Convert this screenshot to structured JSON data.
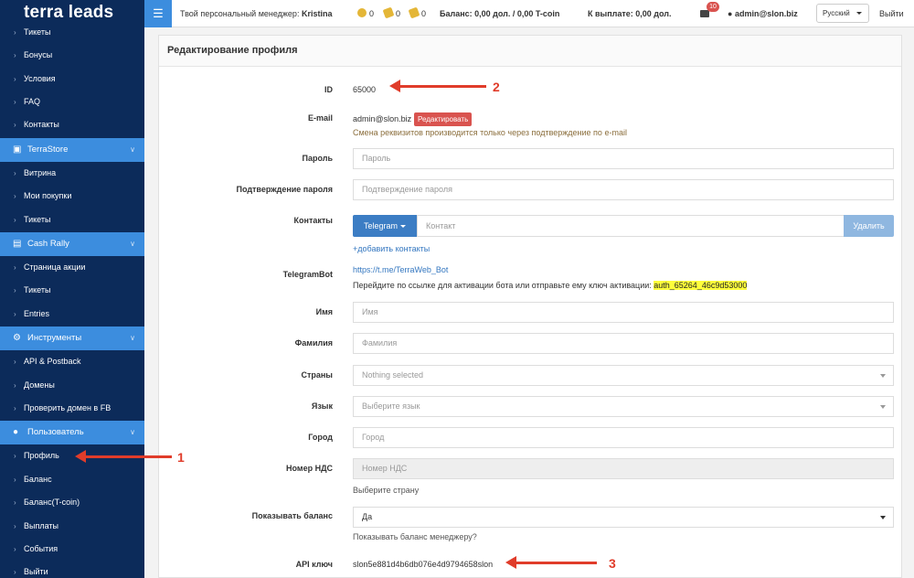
{
  "brand": "terra leads",
  "topbar": {
    "manager_prefix": "Твой персональный менеджер:",
    "manager_name": "Kristina",
    "coins": [
      "0",
      "0",
      "0"
    ],
    "balance": "Баланс: 0,00 дол. / 0,00 T-coin",
    "payout": "К выплате: 0,00 дол.",
    "notifications": "10",
    "user": "admin@slon.biz",
    "language": "Русский",
    "logout": "Выйти"
  },
  "sidebar": {
    "items_top": [
      "Тикеты",
      "Бонусы",
      "Условия",
      "FAQ",
      "Контакты"
    ],
    "terrastore": {
      "title": "TerraStore",
      "items": [
        "Витрина",
        "Мои покупки",
        "Тикеты"
      ]
    },
    "cashrally": {
      "title": "Cash Rally",
      "items": [
        "Страница акции",
        "Тикеты",
        "Entries"
      ]
    },
    "tools": {
      "title": "Инструменты",
      "items": [
        "API & Postback",
        "Домены",
        "Проверить домен в FB"
      ]
    },
    "user": {
      "title": "Пользователь",
      "items": [
        "Профиль",
        "Баланс",
        "Баланс(T-coin)",
        "Выплаты",
        "События",
        "Выйти"
      ]
    }
  },
  "panel": {
    "title": "Редактирование профиля",
    "id_label": "ID",
    "id_value": "65000",
    "email_label": "E-mail",
    "email_value": "admin@slon.biz",
    "edit_button": "Редактировать",
    "email_hint": "Смена реквизитов производится только через подтверждение по e-mail",
    "password_label": "Пароль",
    "password_placeholder": "Пароль",
    "password_confirm_label": "Подтверждение пароля",
    "password_confirm_placeholder": "Подтверждение пароля",
    "contacts_label": "Контакты",
    "contacts_type": "Telegram",
    "contact_placeholder": "Контакт",
    "delete_button": "Удалить",
    "add_contact": "+добавить контакты",
    "telegrambot_label": "TelegramBot",
    "telegrambot_link": "https://t.me/TerraWeb_Bot",
    "telegrambot_hint": "Перейдите по ссылке для активации бота или отправьте ему ключ активации:",
    "telegrambot_key": "auth_65264_46c9d53000",
    "name_label": "Имя",
    "name_placeholder": "Имя",
    "surname_label": "Фамилия",
    "surname_placeholder": "Фамилия",
    "countries_label": "Страны",
    "countries_placeholder": "Nothing selected",
    "language_label": "Язык",
    "language_placeholder": "Выберите язык",
    "city_label": "Город",
    "city_placeholder": "Город",
    "vat_label": "Номер НДС",
    "vat_placeholder": "Номер НДС",
    "vat_hint": "Выберите страну",
    "show_balance_label": "Показывать баланс",
    "show_balance_value": "Да",
    "show_balance_hint": "Показывать баланс менеджеру?",
    "api_key_label": "API ключ",
    "api_key_value": "slon5e881d4b6db076e4d9794658slon"
  },
  "annotations": [
    "1",
    "2",
    "3"
  ],
  "colors": {
    "sidebar": "#0c2b5a",
    "accent": "#3c8dde",
    "annotation": "#e03c2a"
  }
}
